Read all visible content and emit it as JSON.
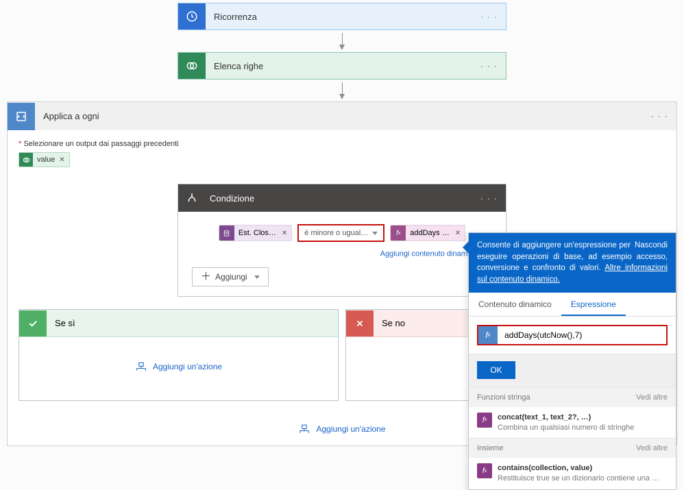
{
  "steps": {
    "recurrence": {
      "title": "Ricorrenza"
    },
    "list_rows": {
      "title": "Elenca righe"
    }
  },
  "foreach": {
    "title": "Applica a ogni",
    "output_label": "Selezionare un output dai passaggi precedenti",
    "token_label": "value"
  },
  "condition": {
    "title": "Condizione",
    "left_chip": "Est. Clos…",
    "operator": "è minore o ugual…",
    "right_chip": "addDays …",
    "dynamic_link": "Aggiungi contenuto dinamico",
    "add_button": "Aggiungi"
  },
  "branches": {
    "yes": "Se sì",
    "no": "Se no",
    "add_action": "Aggiungi un'azione"
  },
  "popup": {
    "hide": "Nascondi",
    "blurb_a": "Consente di aggiungere un'espressione per eseguire operazioni di base, ad esempio accesso, conversione e confronto di valori. ",
    "blurb_link": "Altre informazioni sul contenuto dinamico.",
    "tab_dynamic": "Contenuto dinamico",
    "tab_expr": "Espressione",
    "expression": "addDays(utcNow(),7)",
    "ok": "OK",
    "sections": {
      "string": "Funzioni stringa",
      "collection": "Insieme",
      "more": "Vedi altre"
    },
    "fns": {
      "concat_sig": "concat(text_1, text_2?, …)",
      "concat_desc": "Combina un qualsiasi numero di stringhe",
      "contains_sig": "contains(collection, value)",
      "contains_desc": "Restituisce true se un dizionario contiene una chiave, se …"
    }
  }
}
